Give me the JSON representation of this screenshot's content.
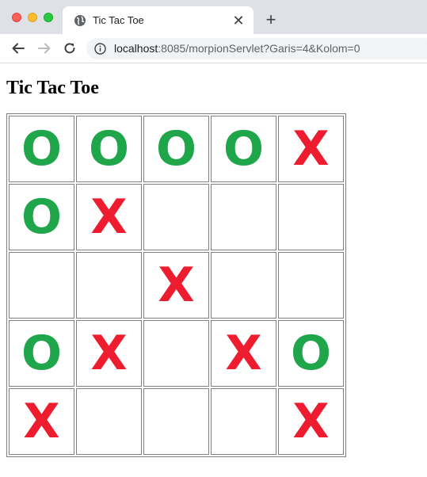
{
  "browser": {
    "tab_title": "Tic Tac Toe",
    "tab_favicon": "globe-icon",
    "close_glyph": "✕",
    "newtab_glyph": "+",
    "url_host": "localhost",
    "url_rest": ":8085/morpionServlet?Garis=4&Kolom=0"
  },
  "page": {
    "title": "Tic Tac Toe"
  },
  "board": [
    [
      "O",
      "O",
      "O",
      "O",
      "X"
    ],
    [
      "O",
      "X",
      "",
      "",
      ""
    ],
    [
      "",
      "",
      "X",
      "",
      ""
    ],
    [
      "O",
      "X",
      "",
      "X",
      "O"
    ],
    [
      "X",
      "",
      "",
      "",
      "X"
    ]
  ],
  "colors": {
    "o_mark": "#1fa64a",
    "x_mark": "#ed1c2e"
  }
}
